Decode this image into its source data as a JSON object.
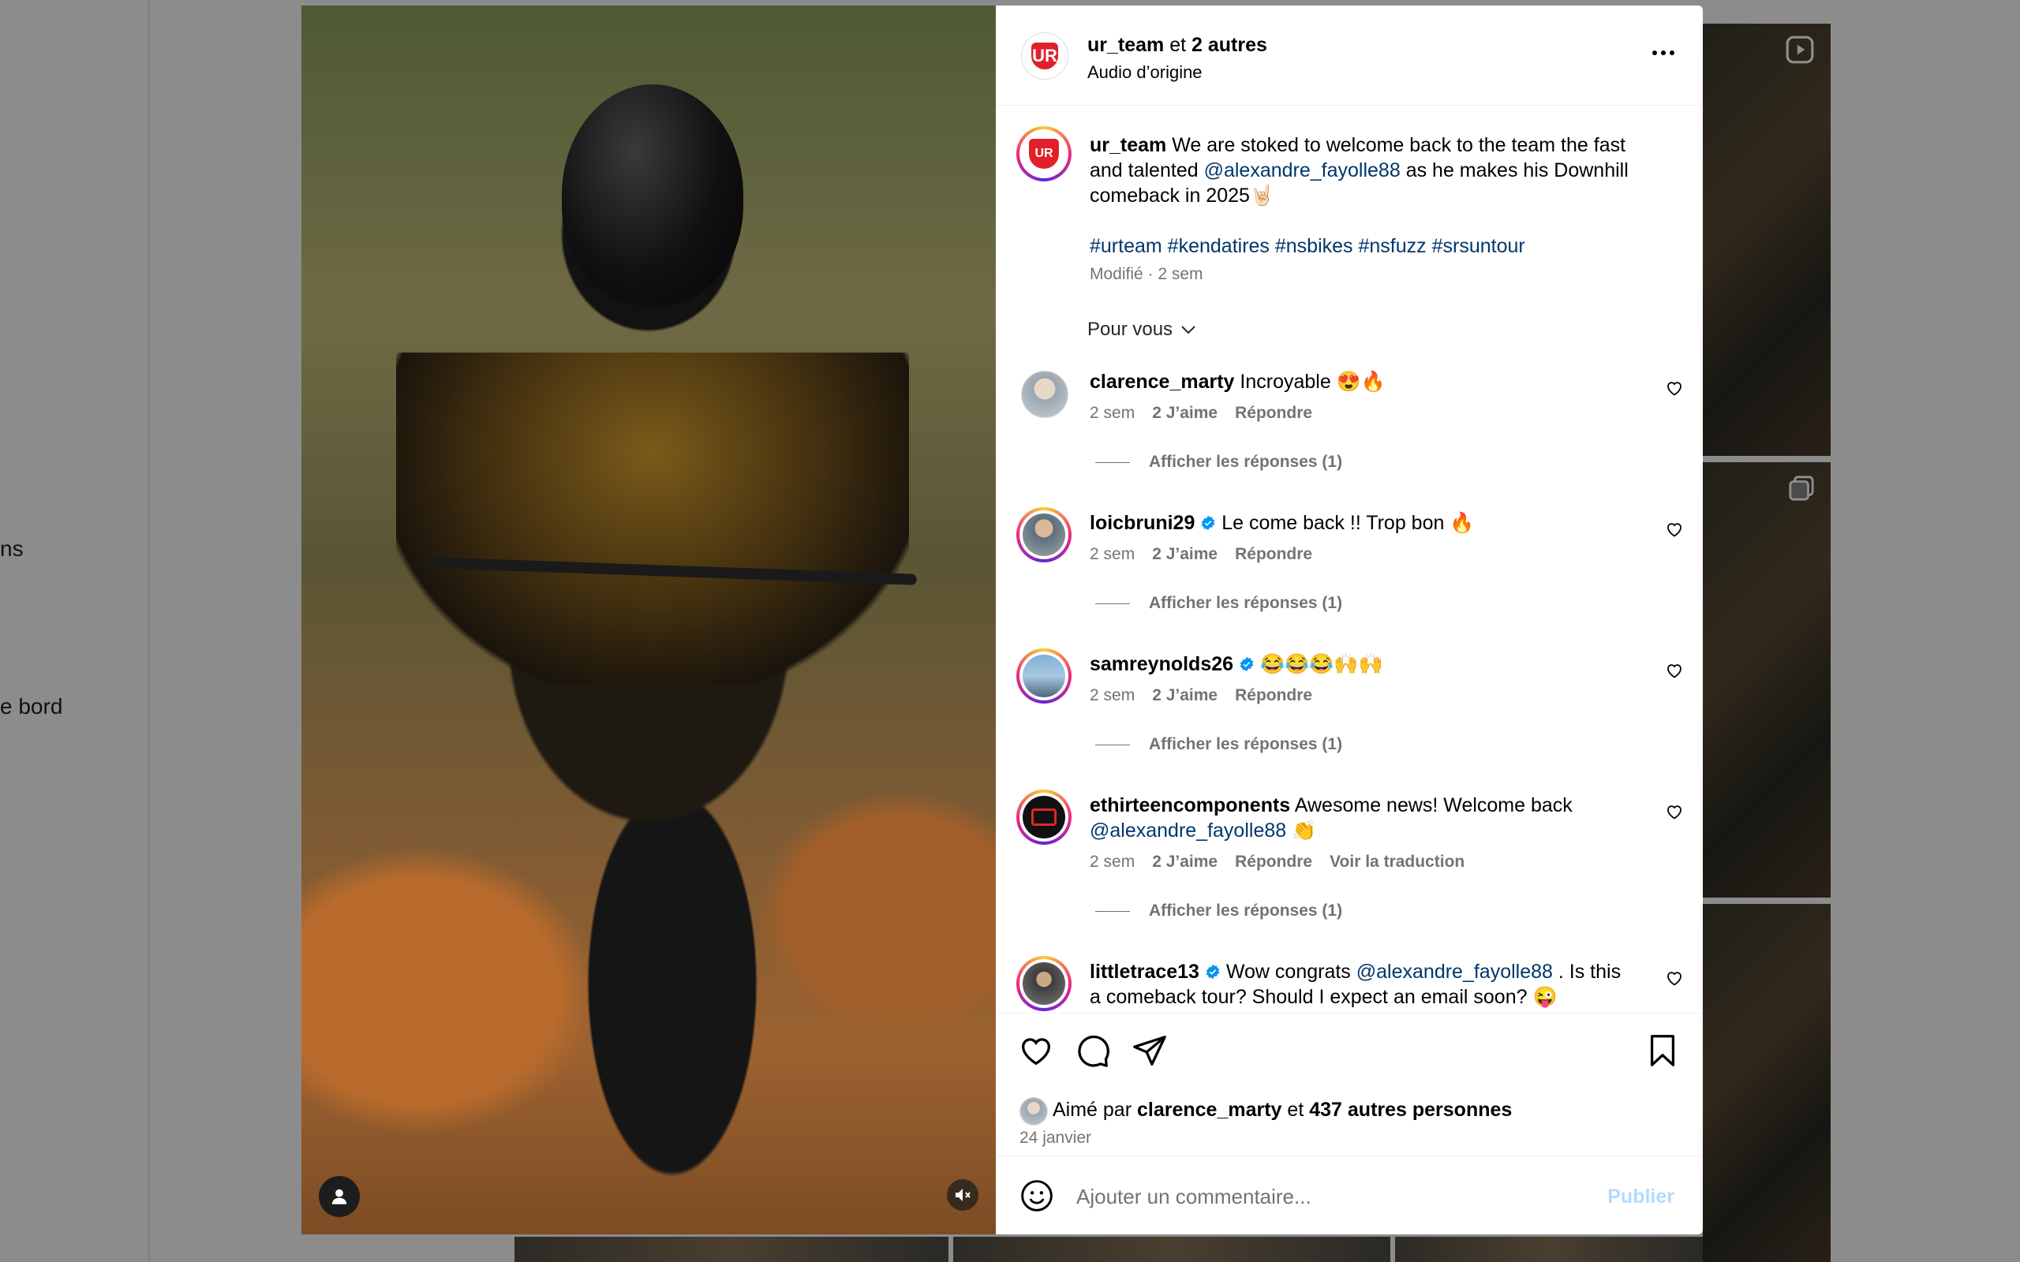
{
  "background": {
    "nav_fragment_1": "ns",
    "nav_fragment_2": "e bord"
  },
  "post": {
    "author": "ur_team",
    "author_joiner": "et",
    "coauthors": "2 autres",
    "audio": "Audio d’origine",
    "caption": {
      "username": "ur_team",
      "text_1": "We are stoked to welcome back to the team the fast and talented",
      "mention": "@alexandre_fayolle88",
      "text_2": "as he makes his Downhill comeback in 2025🤘🏻",
      "hashtags": [
        "#urteam",
        "#kendatires",
        "#nsbikes",
        "#nsfuzz",
        "#srsuntour"
      ],
      "edited": "Modifié · 2 sem"
    },
    "sort_label": "Pour vous"
  },
  "comments": [
    {
      "username": "clarence_marty",
      "verified": false,
      "text_1": "Incroyable 😍🔥",
      "mention": "",
      "text_2": "",
      "time": "2 sem",
      "likes": "2 J’aime",
      "reply": "Répondre",
      "translate": "",
      "replies": "Afficher les réponses (1)"
    },
    {
      "username": "loicbruni29",
      "verified": true,
      "text_1": "Le come back !! Trop bon 🔥",
      "mention": "",
      "text_2": "",
      "time": "2 sem",
      "likes": "2 J’aime",
      "reply": "Répondre",
      "translate": "",
      "replies": "Afficher les réponses (1)"
    },
    {
      "username": "samreynolds26",
      "verified": true,
      "text_1": "😂😂😂🙌🙌",
      "mention": "",
      "text_2": "",
      "time": "2 sem",
      "likes": "2 J’aime",
      "reply": "Répondre",
      "translate": "",
      "replies": "Afficher les réponses (1)"
    },
    {
      "username": "ethirteencomponents",
      "verified": false,
      "text_1": "Awesome news! Welcome back",
      "mention": "@alexandre_fayolle88",
      "text_2": "👏",
      "time": "2 sem",
      "likes": "2 J’aime",
      "reply": "Répondre",
      "translate": "Voir la traduction",
      "replies": "Afficher les réponses (1)"
    },
    {
      "username": "littletrace13",
      "verified": true,
      "text_1": "Wow congrats",
      "mention": "@alexandre_fayolle88",
      "text_2": ". Is this a comeback tour? Should I expect an email soon? 😜",
      "time": "",
      "likes": "",
      "reply": "",
      "translate": "",
      "replies": ""
    }
  ],
  "footer": {
    "liked_by_prefix": "Aimé par",
    "liked_by_user": "clarence_marty",
    "liked_by_joiner": "et",
    "liked_by_others": "437 autres personnes",
    "date": "24 janvier",
    "comment_placeholder": "Ajouter un commentaire...",
    "publish": "Publier"
  },
  "colors": {
    "link": "#00376b",
    "muted": "#737373",
    "verified": "#0095f6",
    "publish_disabled": "#b3dbff",
    "brand_red": "#e1202a"
  },
  "icons": [
    "more-icon",
    "heart-icon",
    "comment-icon",
    "share-icon",
    "bookmark-icon",
    "emoji-icon",
    "user-icon",
    "mute-icon",
    "chevron-down-icon",
    "verified-icon",
    "reel-icon",
    "carousel-icon"
  ]
}
